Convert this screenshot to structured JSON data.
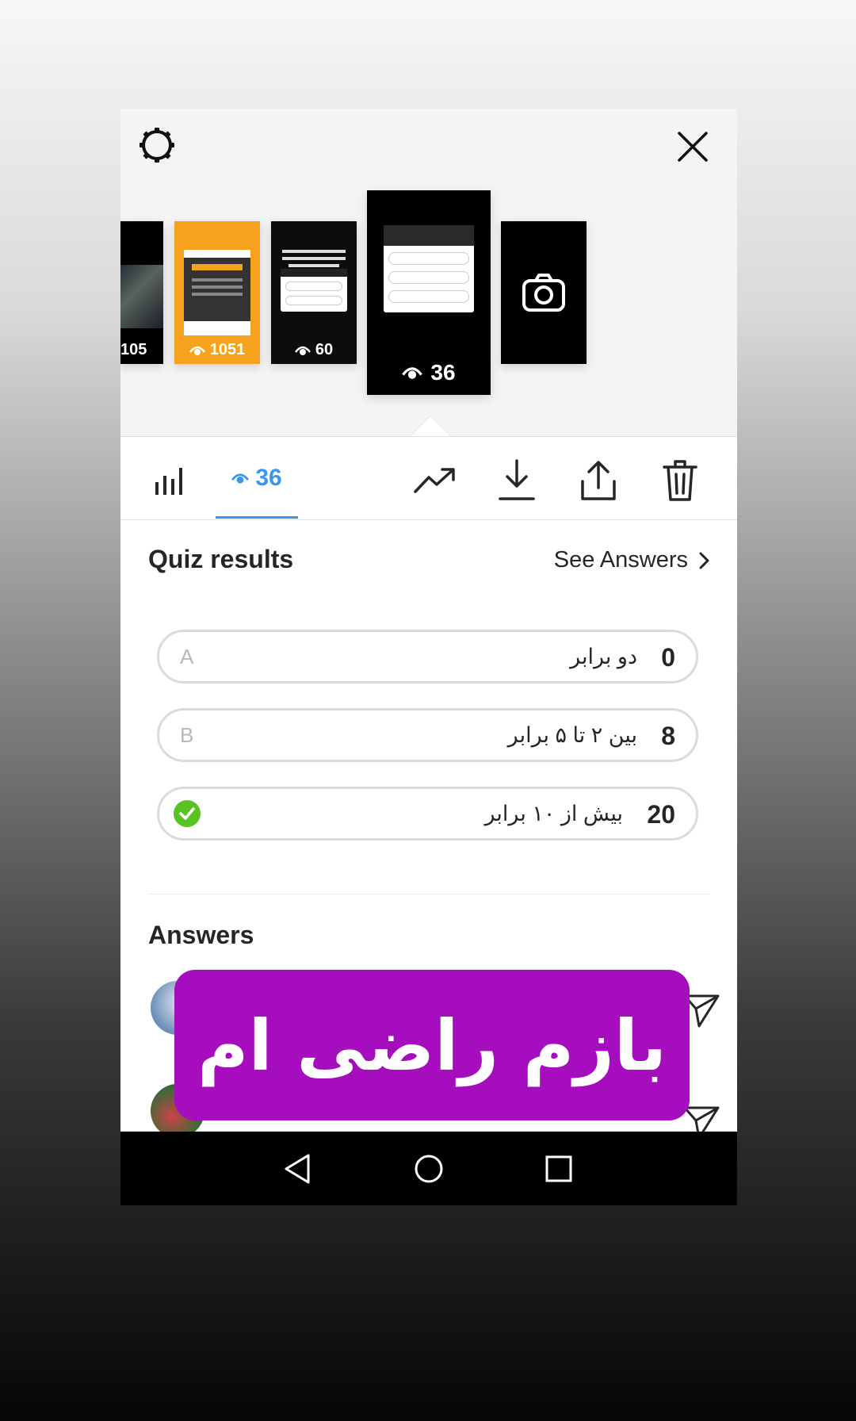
{
  "header": {
    "settings_icon": "gear-icon",
    "close_icon": "close-icon"
  },
  "stories": [
    {
      "views": "105",
      "theme": "photo"
    },
    {
      "views": "1051",
      "theme": "orange"
    },
    {
      "views": "60",
      "theme": "dark-quiz"
    },
    {
      "views": "36",
      "theme": "selected-quiz",
      "selected": true
    },
    {
      "type": "camera",
      "icon": "camera-icon"
    }
  ],
  "toolbar": {
    "viewers_count": "36",
    "icons": [
      "bar-chart-icon",
      "eye-icon",
      "trend-icon",
      "download-icon",
      "share-icon",
      "trash-icon"
    ]
  },
  "quiz": {
    "title": "Quiz results",
    "see_answers": "See Answers",
    "options": [
      {
        "letter": "A",
        "text": "دو برابر",
        "count": "0"
      },
      {
        "letter": "B",
        "text": "بین ۲ تا ۵ برابر",
        "count": "8"
      },
      {
        "letter": "",
        "text": "بیش از ۱۰ برابر",
        "count": "20",
        "correct": true
      }
    ]
  },
  "answers": {
    "title": "Answers"
  },
  "overlay": {
    "text": "بازم راضی ام",
    "color": "#a50dbf"
  },
  "colors": {
    "accent": "#3897f0",
    "correct": "#58c322"
  }
}
